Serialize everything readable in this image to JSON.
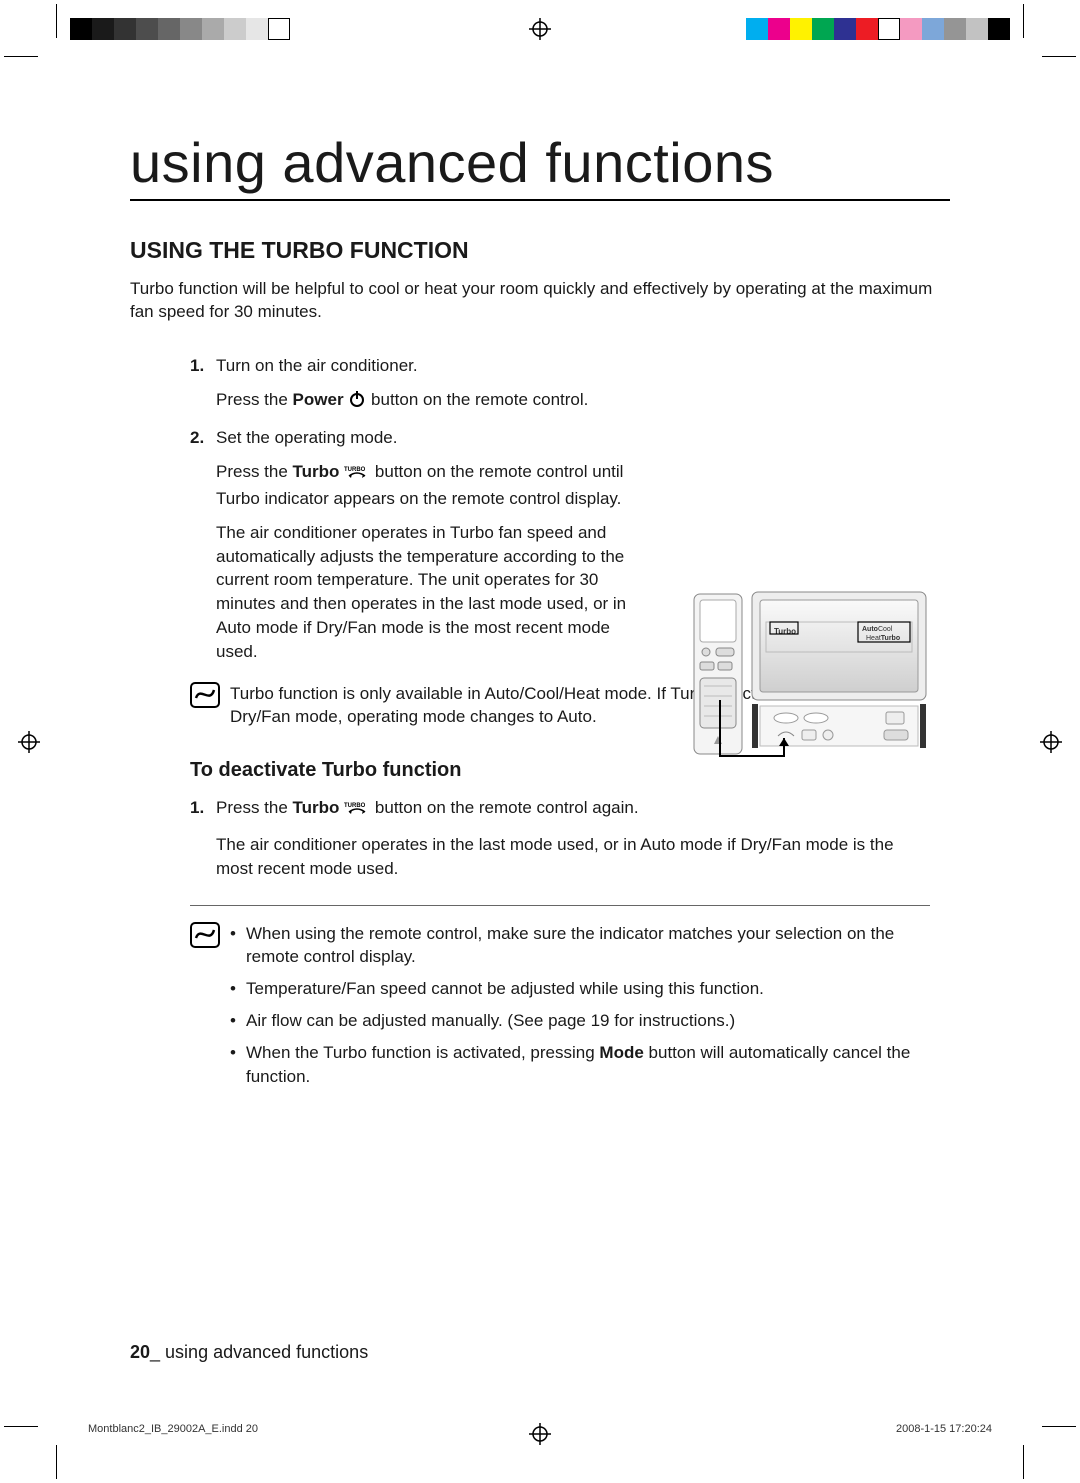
{
  "page": {
    "title": "using advanced functions",
    "footer_label": "using advanced functions",
    "page_number": "20"
  },
  "section": {
    "heading": "USING THE TURBO FUNCTION",
    "intro": "Turbo function will be helpful to cool or heat your room quickly and effectively by operating at the maximum fan speed for 30 minutes."
  },
  "steps": {
    "s1_num": "1.",
    "s1_a": "Turn on the air conditioner.",
    "s1_b_pre": "Press the ",
    "s1_b_bold": "Power",
    "s1_b_post": " button on the remote control.",
    "s2_num": "2.",
    "s2_a": "Set the operating mode.",
    "s2_b_pre": "Press the ",
    "s2_b_bold": "Turbo",
    "s2_b_post": " button on the remote control until Turbo indicator appears on the remote control display.",
    "s2_c": "The air conditioner operates in Turbo fan speed and automatically adjusts the temperature according to the current room temperature. The unit operates for 30 minutes and then operates in the last mode used, or in Auto mode if Dry/Fan mode is the most recent mode used."
  },
  "note1": "Turbo function is only available in Auto/Cool/Heat mode. If Turbo function is selected in Dry/Fan mode, operating mode changes to Auto.",
  "deactivate": {
    "heading": "To deactivate Turbo function",
    "d1_num": "1.",
    "d1_a_pre": "Press the ",
    "d1_a_bold": "Turbo",
    "d1_a_post": " button on the remote control again.",
    "d1_b": "The air conditioner operates in the last mode used, or in Auto mode if Dry/Fan mode is the most recent mode used."
  },
  "notes2": {
    "b1": "When using the remote control, make sure the indicator matches your selection on the remote control display.",
    "b2": "Temperature/Fan speed cannot be adjusted while using this function.",
    "b3": "Air flow can be adjusted manually. (See page 19 for instructions.)",
    "b4_pre": "When the Turbo function is activated, pressing ",
    "b4_bold": "Mode",
    "b4_post": " button will automatically cancel the function."
  },
  "diagram": {
    "badge_turbo": "Turbo",
    "badge_auto": "Auto",
    "badge_cool": "Cool",
    "badge_heat": "Heat",
    "badge_turbo2": "Turbo"
  },
  "slug": {
    "file": "Montblanc2_IB_29002A_E.indd   20",
    "stamp": "2008-1-15   17:20:24"
  },
  "icons": {
    "power": "power-icon",
    "turbo": "turbo-icon",
    "note": "note-icon"
  }
}
